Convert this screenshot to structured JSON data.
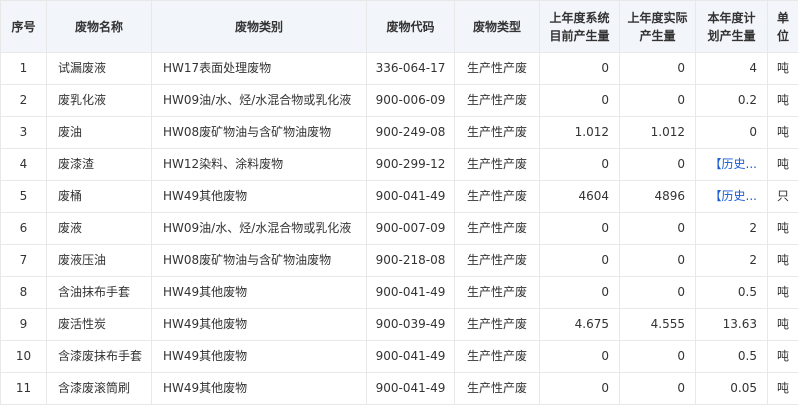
{
  "columns": [
    "序号",
    "废物名称",
    "废物类别",
    "废物代码",
    "废物类型",
    "上年度系统目前产生量",
    "上年度实际产生量",
    "本年度计划产生量",
    "单位"
  ],
  "rows": [
    {
      "no": "1",
      "name": "试漏废液",
      "category": "HW17表面处理废物",
      "code": "336-064-17",
      "type": "生产性产废",
      "sys": "0",
      "actual": "0",
      "plan": "4",
      "plan_link": false,
      "unit": "吨"
    },
    {
      "no": "2",
      "name": "废乳化液",
      "category": "HW09油/水、烃/水混合物或乳化液",
      "code": "900-006-09",
      "type": "生产性产废",
      "sys": "0",
      "actual": "0",
      "plan": "0.2",
      "plan_link": false,
      "unit": "吨"
    },
    {
      "no": "3",
      "name": "废油",
      "category": "HW08废矿物油与含矿物油废物",
      "code": "900-249-08",
      "type": "生产性产废",
      "sys": "1.012",
      "actual": "1.012",
      "plan": "0",
      "plan_link": false,
      "unit": "吨"
    },
    {
      "no": "4",
      "name": "废漆渣",
      "category": "HW12染料、涂料废物",
      "code": "900-299-12",
      "type": "生产性产废",
      "sys": "0",
      "actual": "0",
      "plan": "【历史...",
      "plan_link": true,
      "unit": "吨"
    },
    {
      "no": "5",
      "name": "废桶",
      "category": "HW49其他废物",
      "code": "900-041-49",
      "type": "生产性产废",
      "sys": "4604",
      "actual": "4896",
      "plan": "【历史...",
      "plan_link": true,
      "unit": "只"
    },
    {
      "no": "6",
      "name": "废液",
      "category": "HW09油/水、烃/水混合物或乳化液",
      "code": "900-007-09",
      "type": "生产性产废",
      "sys": "0",
      "actual": "0",
      "plan": "2",
      "plan_link": false,
      "unit": "吨"
    },
    {
      "no": "7",
      "name": "废液压油",
      "category": "HW08废矿物油与含矿物油废物",
      "code": "900-218-08",
      "type": "生产性产废",
      "sys": "0",
      "actual": "0",
      "plan": "2",
      "plan_link": false,
      "unit": "吨"
    },
    {
      "no": "8",
      "name": "含油抹布手套",
      "category": "HW49其他废物",
      "code": "900-041-49",
      "type": "生产性产废",
      "sys": "0",
      "actual": "0",
      "plan": "0.5",
      "plan_link": false,
      "unit": "吨"
    },
    {
      "no": "9",
      "name": "废活性炭",
      "category": "HW49其他废物",
      "code": "900-039-49",
      "type": "生产性产废",
      "sys": "4.675",
      "actual": "4.555",
      "plan": "13.63",
      "plan_link": false,
      "unit": "吨"
    },
    {
      "no": "10",
      "name": "含漆废抹布手套",
      "category": "HW49其他废物",
      "code": "900-041-49",
      "type": "生产性产废",
      "sys": "0",
      "actual": "0",
      "plan": "0.5",
      "plan_link": false,
      "unit": "吨"
    },
    {
      "no": "11",
      "name": "含漆废滚筒刷",
      "category": "HW49其他废物",
      "code": "900-041-49",
      "type": "生产性产废",
      "sys": "0",
      "actual": "0",
      "plan": "0.05",
      "plan_link": false,
      "unit": "吨"
    }
  ]
}
